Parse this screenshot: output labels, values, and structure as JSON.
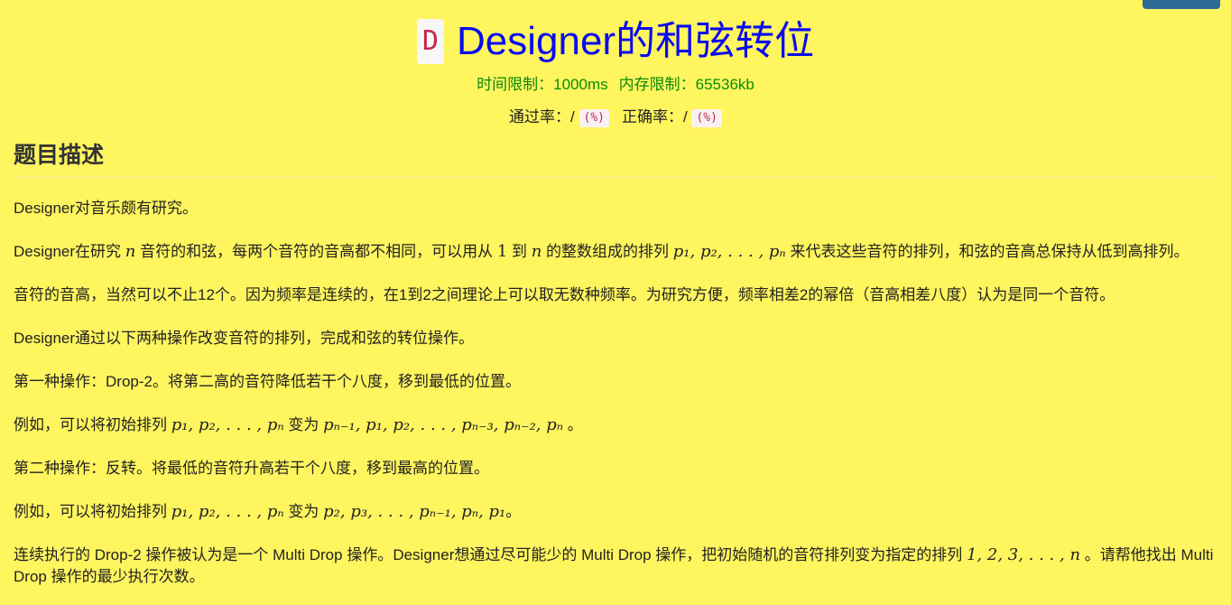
{
  "header": {
    "problem_id": "D",
    "title": "Designer的和弦转位",
    "time_limit": "时间限制：1000ms",
    "memory_limit": "内存限制：65536kb",
    "pass_rate_label": "通过率：/",
    "pass_rate_unit": "(%)",
    "accuracy_label": "正确率：/",
    "accuracy_unit": "(%)"
  },
  "section": {
    "title": "题目描述"
  },
  "description": {
    "p1": "Designer对音乐颇有研究。",
    "p2_a": "Designer在研究 ",
    "p2_n": "n",
    "p2_b": " 音符的和弦，每两个音符的音高都不相同，可以用从 ",
    "p2_one": "1",
    "p2_c": " 到 ",
    "p2_n2": "n",
    "p2_d": " 的整数组成的排列 ",
    "p2_seq": "p₁, p₂, . . . , pₙ",
    "p2_e": " 来代表这些音符的排列，和弦的音高总保持从低到高排列。",
    "p3": "音符的音高，当然可以不止12个。因为频率是连续的，在1到2之间理论上可以取无数种频率。为研究方便，频率相差2的幂倍（音高相差八度）认为是同一个音符。",
    "p4": "Designer通过以下两种操作改变音符的排列，完成和弦的转位操作。",
    "p5": "第一种操作：Drop-2。将第二高的音符降低若干个八度，移到最低的位置。",
    "p6_a": "例如，可以将初始排列 ",
    "p6_seq1": "p₁, p₂, . . . , pₙ",
    "p6_b": " 变为 ",
    "p6_seq2": "pₙ₋₁, p₁, p₂, . . . , pₙ₋₃, pₙ₋₂, pₙ",
    "p6_c": " 。",
    "p7": "第二种操作：反转。将最低的音符升高若干个八度，移到最高的位置。",
    "p8_a": "例如，可以将初始排列 ",
    "p8_seq1": "p₁, p₂, . . . , pₙ",
    "p8_b": " 变为 ",
    "p8_seq2": "p₂, p₃, . . . , pₙ₋₁, pₙ, p₁",
    "p8_c": "。",
    "p9_a": "连续执行的 Drop-2 操作被认为是一个 Multi Drop 操作。Designer想通过尽可能少的 Multi Drop 操作，把初始随机的音符排列变为指定的排列 ",
    "p9_seq": "1, 2, 3, . . . , n",
    "p9_b": " 。请帮他找出 Multi Drop 操作的最少执行次数。"
  },
  "colors": {
    "background": "#fff55f",
    "title": "#0b0bf0",
    "limits": "#0a8a0a",
    "badge_text": "#c7254e",
    "corner_button": "#2f6b95"
  }
}
